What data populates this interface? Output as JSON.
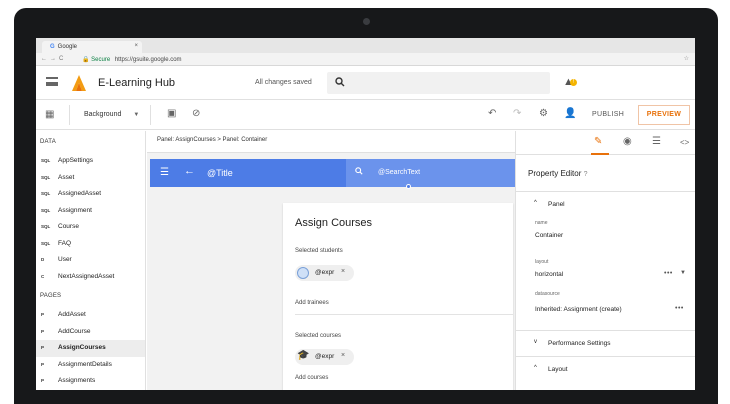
{
  "browser": {
    "tab_title": "Google",
    "tab_close": "×",
    "secure": "Secure",
    "url": "https://gsuite.google.com"
  },
  "header": {
    "app_title": "E-Learning Hub",
    "save_status": "All changes saved",
    "warning_badge": "!"
  },
  "toolbar": {
    "background_select": "Background",
    "publish_label": "PUBLISH",
    "preview_label": "PREVIEW"
  },
  "sidebar": {
    "data_heading": "DATA",
    "data_items": [
      {
        "kind": "SQL",
        "label": "AppSettings"
      },
      {
        "kind": "SQL",
        "label": "Asset"
      },
      {
        "kind": "SQL",
        "label": "AssignedAsset"
      },
      {
        "kind": "SQL",
        "label": "Assignment"
      },
      {
        "kind": "SQL",
        "label": "Course"
      },
      {
        "kind": "SQL",
        "label": "FAQ"
      },
      {
        "kind": "D",
        "label": "User"
      },
      {
        "kind": "C",
        "label": "NextAssignedAsset"
      }
    ],
    "pages_heading": "PAGES",
    "page_items": [
      {
        "kind": "P",
        "label": "AddAsset"
      },
      {
        "kind": "P",
        "label": "AddCourse"
      },
      {
        "kind": "P",
        "label": "AssignCourses"
      },
      {
        "kind": "P",
        "label": "AssignmentDetails"
      },
      {
        "kind": "P",
        "label": "Assignments"
      }
    ]
  },
  "canvas": {
    "breadcrumb": "Panel: AssignCourses > Panel: Container",
    "appbar_title": "@Title",
    "appbar_search": "@SearchText",
    "card_title": "Assign Courses",
    "selected_students_label": "Selected students",
    "student_chip": "@expr",
    "add_trainees_label": "Add trainees",
    "selected_courses_label": "Selected courses",
    "course_chip": "@expr",
    "add_courses_label": "Add courses",
    "chip_remove": "×"
  },
  "property_editor": {
    "title": "Property Editor",
    "panel_section": "Panel",
    "name_label": "name",
    "name_value": "Container",
    "layout_label": "layout",
    "layout_value": "horizontal",
    "datasource_label": "datasource",
    "datasource_value": "Inherited: Assignment (create)",
    "performance_section": "Performance Settings",
    "layout_section": "Layout",
    "more": "•••"
  },
  "colors": {
    "accent": "#e8710a",
    "appbar_blue": "#4d7ce6"
  }
}
